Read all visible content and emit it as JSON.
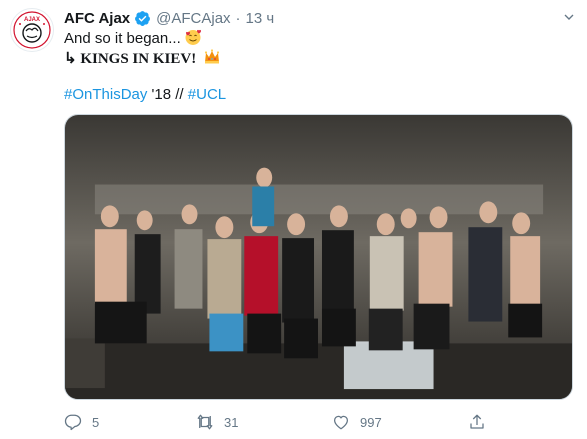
{
  "tweet": {
    "author_name": "AFC Ajax",
    "handle": "@AFCAjax",
    "separator": "·",
    "time": "13 ч",
    "line1": "And so it began...",
    "line2_prefix": "↳",
    "line2_text": "KINGS IN KIEV!",
    "hashtag1": "#OnThisDay",
    "year_text": "'18 //",
    "hashtag2": "#UCL"
  },
  "avatar_text": "AJAX",
  "actions": {
    "reply_count": "5",
    "retweet_count": "31",
    "like_count": "997"
  },
  "icons": {
    "avatar": "ajax-logo-icon",
    "verified": "verified-badge-icon",
    "caret": "chevron-down-icon",
    "emoji1": "smiling-face-with-hearts-icon",
    "emoji2": "crown-icon",
    "reply": "reply-icon",
    "retweet": "retweet-icon",
    "like": "heart-icon",
    "share": "share-icon"
  },
  "colors": {
    "link": "#1b95e0",
    "verified": "#1da1f2",
    "secondary_text": "#657786",
    "ajax_red": "#d2122e"
  }
}
